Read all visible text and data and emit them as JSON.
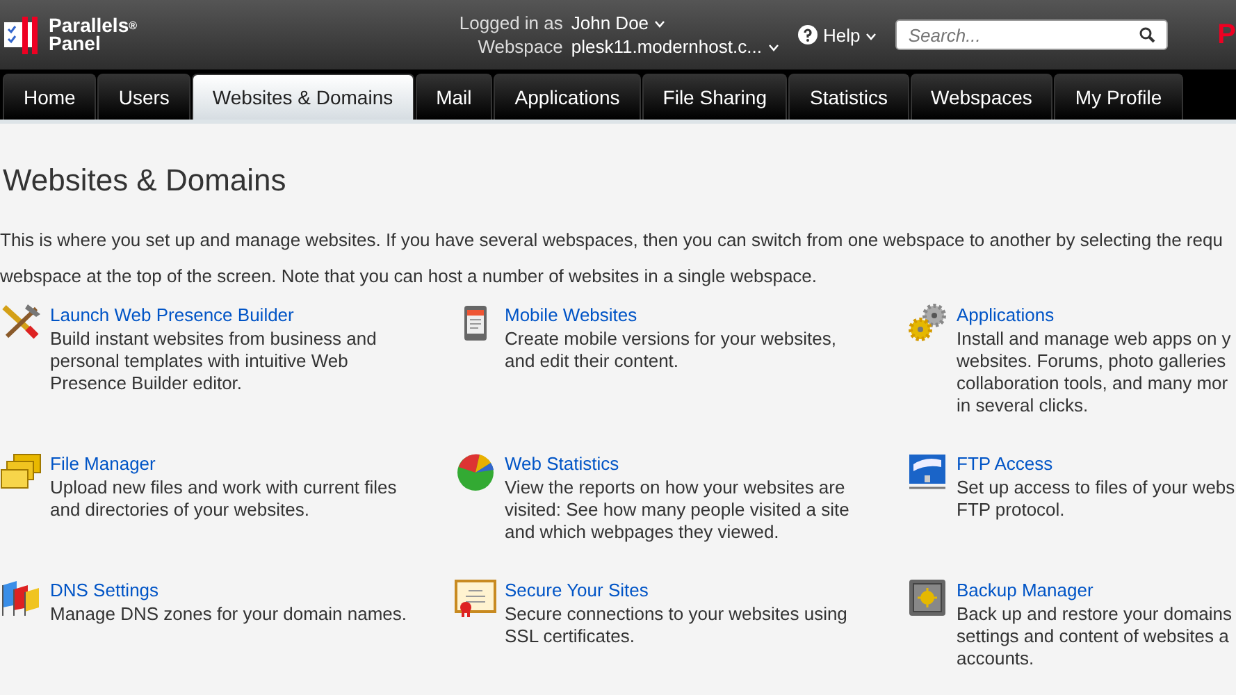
{
  "header": {
    "logo": {
      "brand": "Parallels",
      "mark": "®",
      "product": "Panel"
    },
    "logged_in_label": "Logged in as",
    "user": "John Doe",
    "webspace_label": "Webspace",
    "webspace": "plesk11.modernhost.c...",
    "help": "Help",
    "search": {
      "placeholder": "Search..."
    },
    "corner_logo": "P"
  },
  "tabs": [
    {
      "label": "Home",
      "selected": false
    },
    {
      "label": "Users",
      "selected": false
    },
    {
      "label": "Websites & Domains",
      "selected": true
    },
    {
      "label": "Mail",
      "selected": false
    },
    {
      "label": "Applications",
      "selected": false
    },
    {
      "label": "File Sharing",
      "selected": false
    },
    {
      "label": "Statistics",
      "selected": false
    },
    {
      "label": "Webspaces",
      "selected": false
    },
    {
      "label": "My Profile",
      "selected": false
    }
  ],
  "page": {
    "title": "Websites & Domains",
    "intro": [
      "This is where you set up and manage websites. If you have several webspaces, then you can switch from one webspace to another by selecting the requ",
      "webspace at the top of the screen. Note that you can host a number of websites in a single webspace."
    ]
  },
  "tools": [
    {
      "kind": "builder",
      "title": "Launch Web Presence Builder",
      "lines": [
        "Build instant websites from business and",
        "personal templates with intuitive Web",
        "Presence Builder editor."
      ]
    },
    {
      "kind": "mobile",
      "title": "Mobile Websites",
      "lines": [
        "Create mobile versions for your websites,",
        "and edit their content."
      ]
    },
    {
      "kind": "apps",
      "title": "Applications",
      "lines": [
        "Install and manage web apps on y",
        "websites. Forums, photo galleries",
        "collaboration tools, and many mor",
        "in several clicks."
      ]
    },
    {
      "kind": "files",
      "title": "File Manager",
      "lines": [
        "Upload new files and work with current files",
        "and directories of your websites."
      ]
    },
    {
      "kind": "stats",
      "title": "Web Statistics",
      "lines": [
        "View the reports on how your websites are",
        "visited: See how many people visited a site",
        "and which webpages they viewed."
      ]
    },
    {
      "kind": "ftp",
      "title": "FTP Access",
      "lines": [
        "Set up access to files of your webs",
        "FTP protocol."
      ]
    },
    {
      "kind": "dns",
      "title": "DNS Settings",
      "lines": [
        "Manage DNS zones for your domain names."
      ]
    },
    {
      "kind": "ssl",
      "title": "Secure Your Sites",
      "lines": [
        "Secure connections to your websites using",
        "SSL certificates."
      ]
    },
    {
      "kind": "backup",
      "title": "Backup Manager",
      "lines": [
        "Back up and restore your domains",
        "settings and content of websites a",
        "accounts."
      ]
    }
  ]
}
